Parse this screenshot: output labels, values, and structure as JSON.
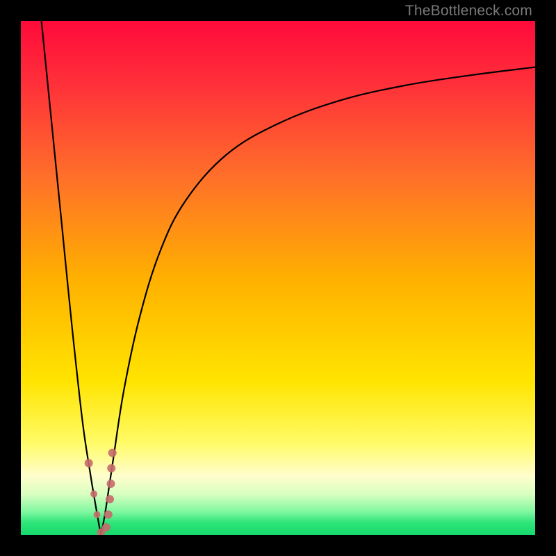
{
  "watermark": {
    "text": "TheBottleneck.com"
  },
  "colors": {
    "frame": "#000000",
    "curve": "#000000",
    "dot": "#c76a6a",
    "gradient_stops": [
      {
        "pos": 0.0,
        "color": "#ff0a3a"
      },
      {
        "pos": 0.12,
        "color": "#ff2f3a"
      },
      {
        "pos": 0.3,
        "color": "#ff6e2a"
      },
      {
        "pos": 0.5,
        "color": "#ffb000"
      },
      {
        "pos": 0.7,
        "color": "#ffe400"
      },
      {
        "pos": 0.82,
        "color": "#fffb66"
      },
      {
        "pos": 0.885,
        "color": "#fffdcc"
      },
      {
        "pos": 0.92,
        "color": "#d9ffc0"
      },
      {
        "pos": 0.955,
        "color": "#7ef7a0"
      },
      {
        "pos": 0.975,
        "color": "#2fe57a"
      },
      {
        "pos": 1.0,
        "color": "#14d96c"
      }
    ]
  },
  "chart_data": {
    "type": "line",
    "title": "",
    "xlabel": "",
    "ylabel": "",
    "xlim": [
      0,
      100
    ],
    "ylim": [
      0,
      100
    ],
    "x_ticks": [],
    "y_ticks": [],
    "grid": false,
    "legend": false,
    "description": "Bottleneck-style V-curve on a red→yellow→green vertical gradient. Two black curves: a steep left branch descending from top to the valley near x≈15, and a right branch rising logarithmically from the valley toward the top-right. Coral dots mark points near the valley.",
    "series": [
      {
        "name": "left-branch",
        "x": [
          4.0,
          6.0,
          8.0,
          10.0,
          12.0,
          13.5,
          14.5,
          15.2,
          15.6
        ],
        "y": [
          100.0,
          80.0,
          60.0,
          40.0,
          22.0,
          12.0,
          6.0,
          2.0,
          0.0
        ]
      },
      {
        "name": "right-branch",
        "x": [
          15.6,
          16.5,
          18.0,
          20.0,
          23.0,
          27.0,
          32.0,
          40.0,
          50.0,
          62.0,
          75.0,
          88.0,
          100.0
        ],
        "y": [
          0.0,
          5.0,
          15.0,
          28.0,
          42.0,
          55.0,
          65.0,
          74.0,
          80.0,
          84.5,
          87.5,
          89.5,
          91.0
        ]
      }
    ],
    "points": {
      "name": "valley-dots",
      "x": [
        13.2,
        14.2,
        14.8,
        15.6,
        16.6,
        17.0,
        17.3,
        17.5,
        17.6,
        17.8
      ],
      "y": [
        14.0,
        8.0,
        4.0,
        0.5,
        1.5,
        4.0,
        7.0,
        10.0,
        13.0,
        16.0
      ],
      "r": [
        6,
        5,
        5,
        6,
        6,
        6,
        6,
        6,
        6,
        6
      ]
    }
  }
}
